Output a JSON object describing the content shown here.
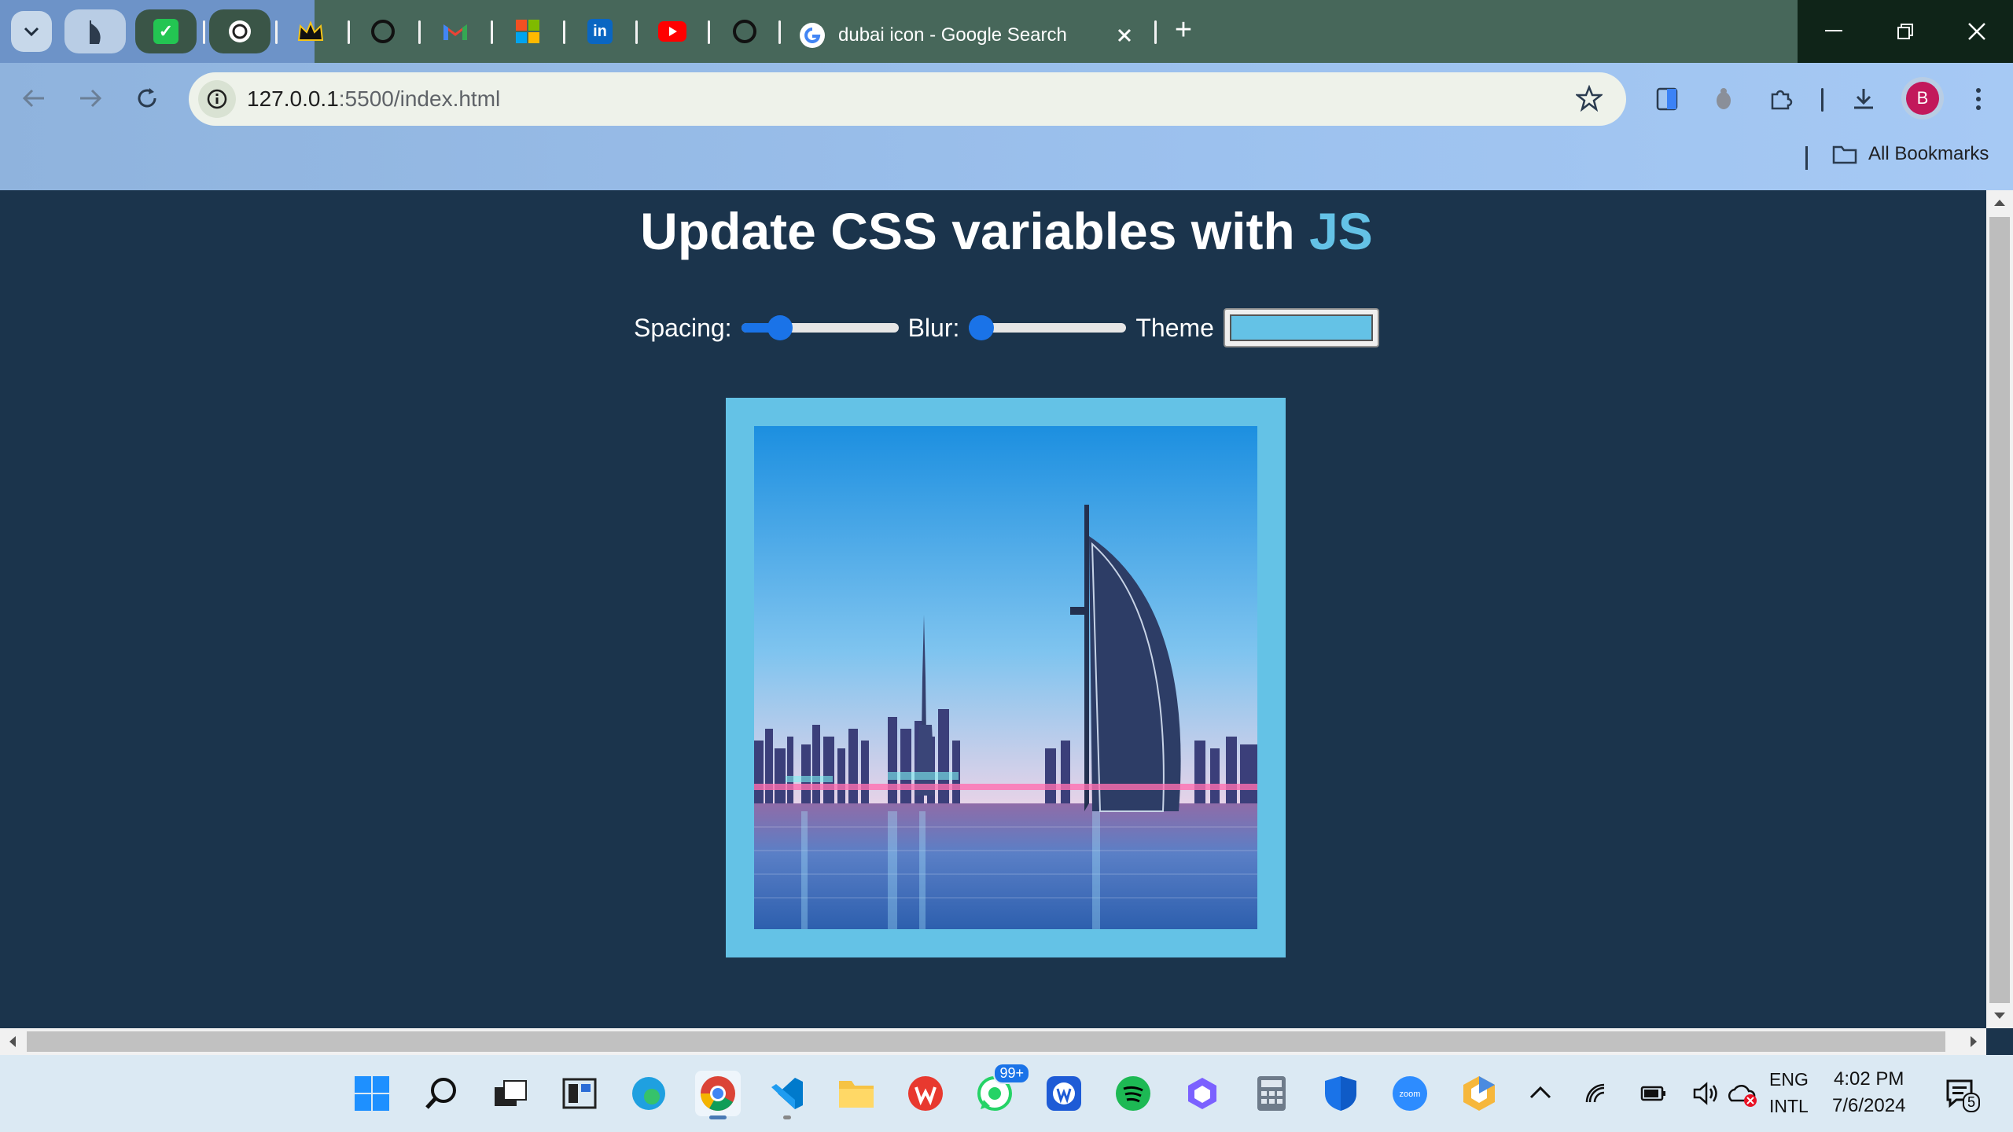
{
  "browser": {
    "active_tab_title": "dubai icon - Google Search",
    "url_host": "127.0.0.1",
    "url_path": ":5500/index.html",
    "all_bookmarks_label": "All Bookmarks",
    "profile_initial": "B"
  },
  "page": {
    "title_main": "Update CSS variables with ",
    "title_accent": "JS",
    "spacing_label": "Spacing:",
    "blur_label": "Blur:",
    "theme_label": "Theme",
    "spacing_value": 0.2,
    "blur_value": 0.0,
    "theme_color": "#64c2e6"
  },
  "taskbar": {
    "whatsapp_badge": "99+",
    "lang_top": "ENG",
    "lang_bottom": "INTL",
    "time": "4:02 PM",
    "date": "7/6/2024",
    "notification_count": "5"
  },
  "colors": {
    "page_bg": "#1b344c",
    "accent": "#64c2e6",
    "slider": "#1a73e8"
  }
}
